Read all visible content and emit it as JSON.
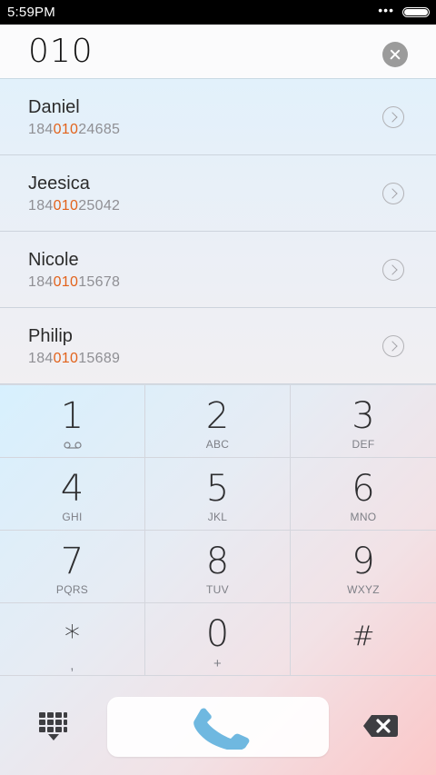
{
  "status_bar": {
    "time": "5:59PM",
    "dots": "•••"
  },
  "dialer": {
    "typed_number": "010"
  },
  "contacts": [
    {
      "name": "Daniel",
      "phone_prefix": "184",
      "phone_match": "010",
      "phone_suffix": "24685"
    },
    {
      "name": "Jeesica",
      "phone_prefix": "184",
      "phone_match": "010",
      "phone_suffix": "25042"
    },
    {
      "name": "Nicole",
      "phone_prefix": "184",
      "phone_match": "010",
      "phone_suffix": "15678"
    },
    {
      "name": "Philip",
      "phone_prefix": "184",
      "phone_match": "010",
      "phone_suffix": "15689"
    }
  ],
  "keypad": [
    {
      "digit": "1",
      "sub": "",
      "icon": "voicemail-icon"
    },
    {
      "digit": "2",
      "sub": "ABC"
    },
    {
      "digit": "3",
      "sub": "DEF"
    },
    {
      "digit": "4",
      "sub": "GHI"
    },
    {
      "digit": "5",
      "sub": "JKL"
    },
    {
      "digit": "6",
      "sub": "MNO"
    },
    {
      "digit": "7",
      "sub": "PQRS"
    },
    {
      "digit": "8",
      "sub": "TUV"
    },
    {
      "digit": "9",
      "sub": "WXYZ"
    },
    {
      "digit": "*",
      "sub": ","
    },
    {
      "digit": "0",
      "sub": "+"
    },
    {
      "digit": "#",
      "sub": ""
    }
  ],
  "icons": {
    "dialpad": "dialpad-grid-icon",
    "call": "phone-handset-icon",
    "backspace": "backspace-icon",
    "clear": "clear-circle-icon",
    "details": "chevron-right-circle-icon"
  },
  "colors": {
    "match_highlight": "#e2621b",
    "call_icon": "#6fb8e0",
    "keypad_gradient_start": "#d7f0fe",
    "keypad_gradient_end": "#fbc7c8"
  }
}
